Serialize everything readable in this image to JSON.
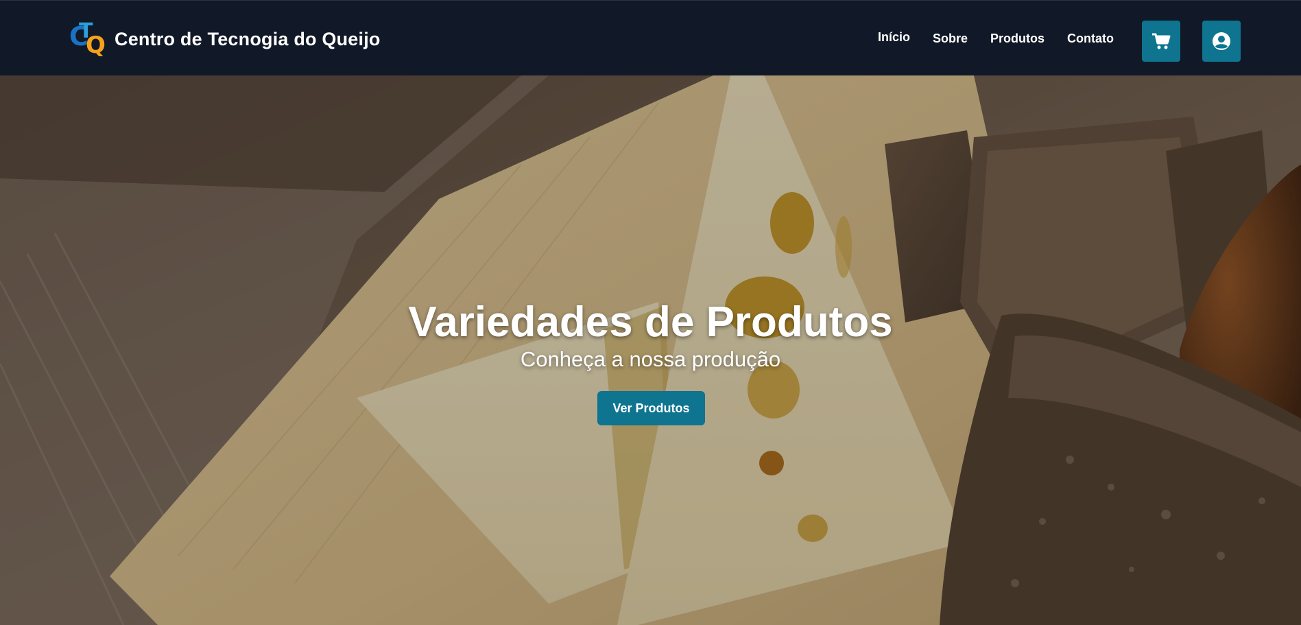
{
  "brand": {
    "logo_letters": {
      "c": "C",
      "t": "T",
      "q": "Q"
    },
    "title": "Centro de Tecnogia do Queijo"
  },
  "nav": {
    "links": [
      "Início",
      "Sobre",
      "Produtos",
      "Contato"
    ],
    "cart_icon": "cart-icon",
    "user_icon": "user-circle-icon"
  },
  "hero": {
    "title": "Variedades de Produtos",
    "subtitle": "Conheça a nossa produção",
    "button_label": "Ver Produtos"
  },
  "colors": {
    "navbar": "#111827",
    "accent": "#0e7490",
    "logo_blue": "#1a73c1",
    "logo_orange": "#f5a11a"
  }
}
